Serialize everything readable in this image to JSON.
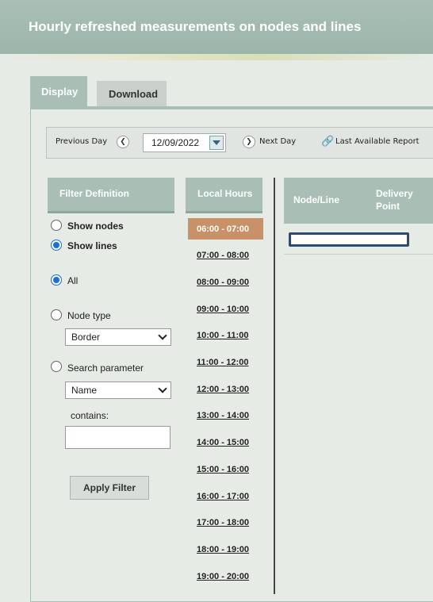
{
  "header": {
    "title": "Hourly refreshed measurements on nodes and lines"
  },
  "tabs": [
    {
      "label": "Display",
      "active": true
    },
    {
      "label": "Download",
      "active": false
    }
  ],
  "toolbar": {
    "prev_label": "Previous Day",
    "date_value": "12/09/2022",
    "next_label": "Next Day",
    "last_report_label": "Last Available Report"
  },
  "filter": {
    "heading": "Filter Definition",
    "show_nodes": "Show nodes",
    "show_lines": "Show lines",
    "all": "All",
    "node_type": "Node type",
    "node_type_value": "Border",
    "search_parameter": "Search parameter",
    "search_param_value": "Name",
    "contains": "contains:",
    "contains_value": "",
    "apply": "Apply Filter",
    "selected_view": "Show lines",
    "selected_mode": "All"
  },
  "hours": {
    "heading": "Local Hours",
    "selected": "06:00 - 07:00",
    "items": [
      "07:00 - 08:00",
      "08:00 - 09:00",
      "09:00 - 10:00",
      "10:00 - 11:00",
      "11:00 - 12:00",
      "12:00 - 13:00",
      "13:00 - 14:00",
      "14:00 - 15:00",
      "15:00 - 16:00",
      "16:00 - 17:00",
      "17:00 - 18:00",
      "18:00 - 19:00",
      "19:00 - 20:00"
    ]
  },
  "table": {
    "col_node_line": "Node/Line",
    "col_delivery_point": "Delivery Point"
  },
  "colors": {
    "header": "#a9bfb6",
    "selected_hour": "#c99167",
    "radio_accent": "#1a6fd8"
  }
}
